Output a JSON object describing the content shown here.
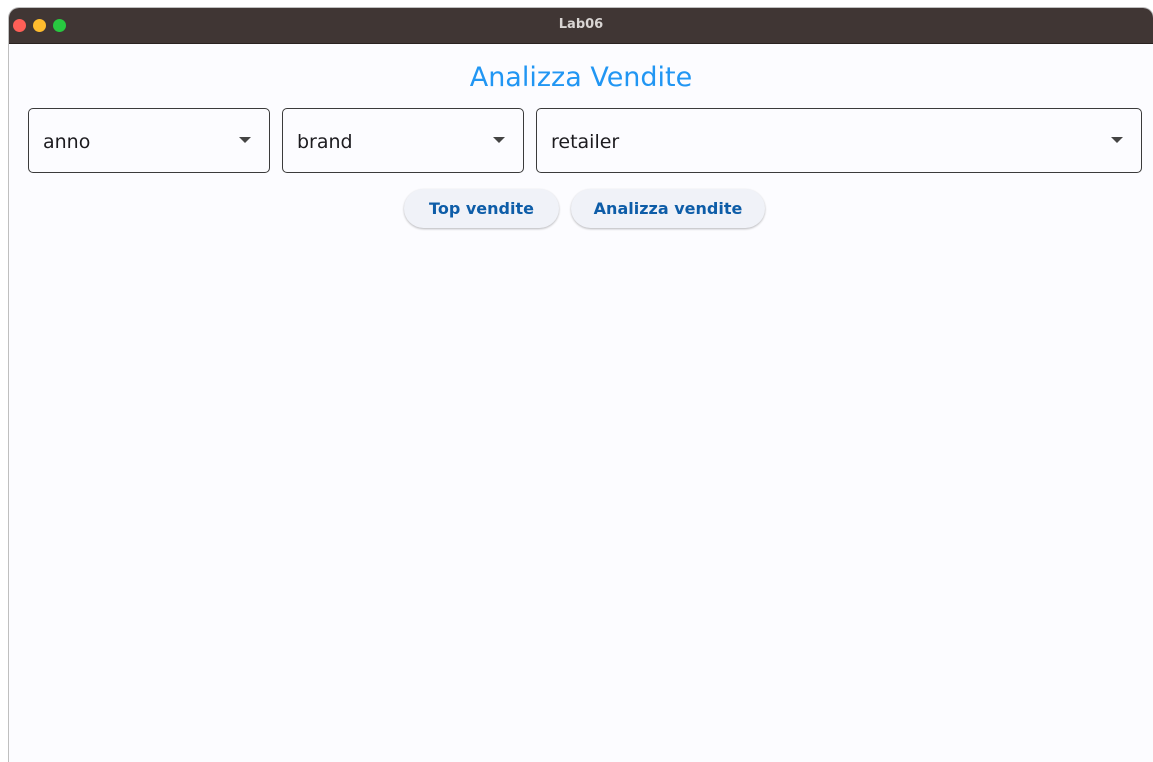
{
  "window": {
    "title": "Lab06",
    "controls": [
      "close",
      "minimize",
      "maximize"
    ]
  },
  "page": {
    "title": "Analizza Vendite"
  },
  "filters": {
    "anno": {
      "label": "anno",
      "icon": "arrow-drop-down-icon"
    },
    "brand": {
      "label": "brand",
      "icon": "arrow-drop-down-icon"
    },
    "retailer": {
      "label": "retailer",
      "icon": "arrow-drop-down-icon"
    }
  },
  "actions": {
    "top_vendite": "Top vendite",
    "analizza_vendite": "Analizza vendite"
  },
  "colors": {
    "title": "#2196f3",
    "button_text": "#0e5da8",
    "button_bg": "#f0f2f8",
    "titlebar": "#403634",
    "background": "#fcfcff"
  }
}
